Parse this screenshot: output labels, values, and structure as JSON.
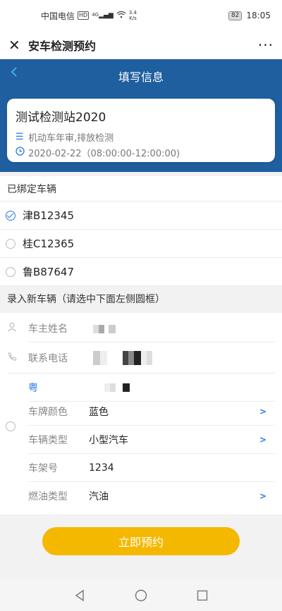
{
  "status_bar": {
    "carrier": "中国电信",
    "hd": "HD",
    "network": "4G",
    "speed_value": "3.4",
    "speed_unit": "K/s",
    "battery": "82",
    "time": "18:05"
  },
  "app_bar": {
    "title": "安车检测预约",
    "more": "···"
  },
  "header": {
    "title": "填写信息"
  },
  "station_card": {
    "name": "测试检测站2020",
    "services": "机动车年审,排放检测",
    "datetime": "2020-02-22（08:00:00-12:00:00)"
  },
  "bound_vehicles": {
    "heading": "已绑定车辆",
    "items": [
      {
        "plate": "津B12345",
        "checked": true
      },
      {
        "plate": "桂C12365",
        "checked": false
      },
      {
        "plate": "鲁B87647",
        "checked": false
      }
    ]
  },
  "new_vehicle": {
    "heading": "录入新车辆（请选中下面左侧圆框）",
    "owner_label": "车主姓名",
    "phone_label": "联系电话",
    "province": "粤",
    "plate_color_label": "车牌颜色",
    "plate_color_value": "蓝色",
    "vehicle_type_label": "车辆类型",
    "vehicle_type_value": "小型汽车",
    "frame_label": "车架号",
    "frame_value": "1234",
    "fuel_label": "燃油类型",
    "fuel_value": "汽油",
    "arrow": ">"
  },
  "submit": {
    "label": "立即预约"
  },
  "colors": {
    "header_blue": "#1f5fa0",
    "accent_blue": "#2a7ae2",
    "button_yellow": "#f5b800"
  }
}
